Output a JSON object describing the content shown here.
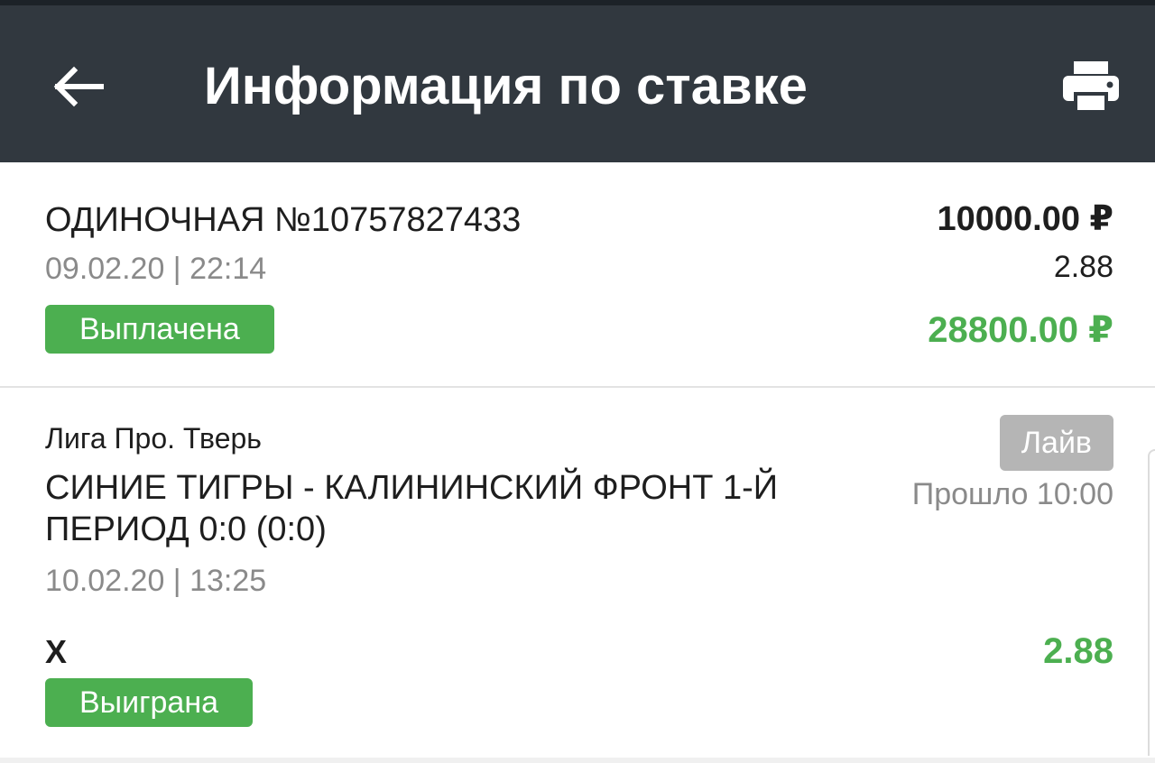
{
  "header": {
    "title": "Информация по ставке",
    "back_icon": "arrow-left-icon",
    "print_icon": "printer-icon",
    "background": "#31383f"
  },
  "bet": {
    "title": "ОДИНОЧНАЯ №10757827433",
    "datetime": "09.02.20 | 22:14",
    "status": "Выплачена",
    "stake": "10000.00 ₽",
    "odds": "2.88",
    "payout": "28800.00 ₽"
  },
  "event": {
    "league": "Лига Про. Тверь",
    "name": "СИНИЕ ТИГРЫ - КАЛИНИНСКИЙ ФРОНТ 1-Й ПЕРИОД 0:0 (0:0)",
    "datetime": "10.02.20 | 13:25",
    "live_label": "Лайв",
    "elapsed": "Прошло 10:00",
    "outcome": "X",
    "odds": "2.88",
    "status": "Выиграна"
  },
  "colors": {
    "accent_green": "#4caf50",
    "live_gray": "#b5b5b5",
    "muted_text": "#8a8a8a"
  }
}
